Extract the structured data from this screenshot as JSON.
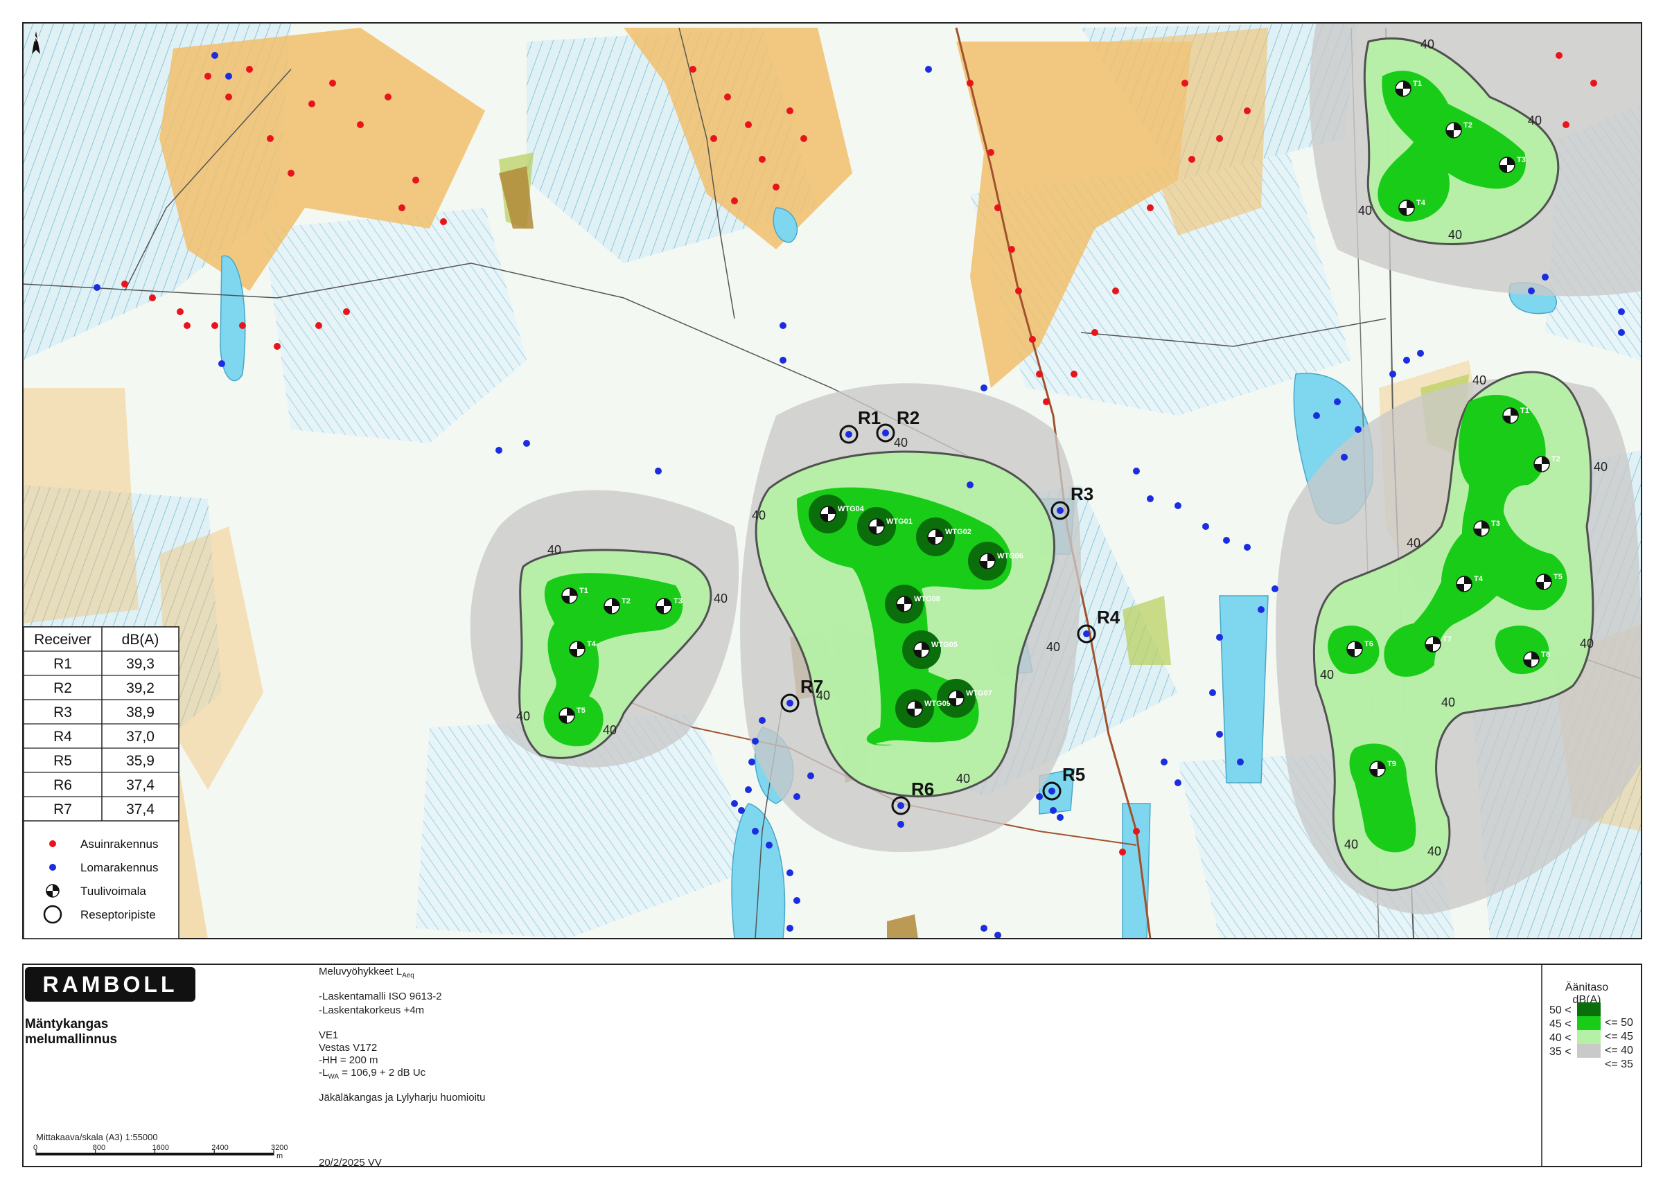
{
  "map": {
    "north_arrow": "N",
    "contour_label": "40"
  },
  "turbines": [
    {
      "id": "t-west-1",
      "label": "T1"
    },
    {
      "id": "t-west-2",
      "label": "T2"
    },
    {
      "id": "t-west-3",
      "label": "T3"
    },
    {
      "id": "t-west-4",
      "label": "T4"
    },
    {
      "id": "t-west-5",
      "label": "T5"
    },
    {
      "id": "wtg04",
      "label": "WTG04"
    },
    {
      "id": "wtg01",
      "label": "WTG01"
    },
    {
      "id": "wtg02",
      "label": "WTG02"
    },
    {
      "id": "wtg06",
      "label": "WTG06"
    },
    {
      "id": "wtg08",
      "label": "WTG08"
    },
    {
      "id": "wtg05",
      "label": "WTG05"
    },
    {
      "id": "wtg09",
      "label": "WTG09"
    },
    {
      "id": "wtg07",
      "label": "WTG07"
    },
    {
      "id": "t-ne-1",
      "label": "T1"
    },
    {
      "id": "t-ne-2",
      "label": "T2"
    },
    {
      "id": "t-ne-3",
      "label": "T3"
    },
    {
      "id": "t-ne-4",
      "label": "T4"
    },
    {
      "id": "t-e-1",
      "label": "T1"
    },
    {
      "id": "t-e-2",
      "label": "T2"
    },
    {
      "id": "t-e-3",
      "label": "T3"
    },
    {
      "id": "t-e-4",
      "label": "T4"
    },
    {
      "id": "t-e-5",
      "label": "T5"
    },
    {
      "id": "t-e-6",
      "label": "T6"
    },
    {
      "id": "t-e-7",
      "label": "T7"
    },
    {
      "id": "t-e-8",
      "label": "T8"
    },
    {
      "id": "t-e-9",
      "label": "T9"
    }
  ],
  "receivers": [
    "R1",
    "R2",
    "R3",
    "R4",
    "R5",
    "R6",
    "R7"
  ],
  "receiver_table": {
    "col_receiver": "Receiver",
    "col_db": "dB(A)",
    "rows": [
      {
        "receiver": "R1",
        "db": "39,3"
      },
      {
        "receiver": "R2",
        "db": "39,2"
      },
      {
        "receiver": "R3",
        "db": "38,9"
      },
      {
        "receiver": "R4",
        "db": "37,0"
      },
      {
        "receiver": "R5",
        "db": "35,9"
      },
      {
        "receiver": "R6",
        "db": "37,4"
      },
      {
        "receiver": "R7",
        "db": "37,4"
      }
    ]
  },
  "legend": {
    "items": [
      {
        "symbol": "red-dot",
        "label": "Asuinrakennus",
        "color": "#e8141c"
      },
      {
        "symbol": "blue-dot",
        "label": "Lomarakennus",
        "color": "#1a2ee0"
      },
      {
        "symbol": "turbine",
        "label": "Tuulivoimala"
      },
      {
        "symbol": "ring",
        "label": "Reseptoripiste"
      }
    ]
  },
  "title_block": {
    "logo": "RAMBOLL",
    "project_line1": "Mäntykangas",
    "project_line2": "melumallinnus",
    "heading": "Meluvyöhykkeet L",
    "heading_sub": "Aeq",
    "model_line": "-Laskentamalli ISO 9613-2",
    "height_line": "-Laskentakorkeus +4m",
    "variant": "VE1",
    "turbine_model": "Vestas V172",
    "hub_height": "-HH = 200 m",
    "lwa_prefix": "-L",
    "lwa_sub": "WA",
    "lwa_value": " = 106,9 + 2 dB Uc",
    "note": "Jäkäläkangas ja Lylyharju huomioitu",
    "scale_text": "Mittakaava/skala (A3) 1:55000",
    "scale_ticks": [
      "0",
      "800",
      "1600",
      "2400",
      "3200"
    ],
    "scale_unit": "m",
    "date": "20/2/2025 VV"
  },
  "noise_legend": {
    "title": "Äänitaso",
    "unit": "dB(A)",
    "left_labels": [
      "50 <",
      "45 <",
      "40 <",
      "35 <"
    ],
    "right_labels": [
      "<= 50",
      "<= 45",
      "<= 40",
      "<= 35"
    ],
    "colors": {
      "band_50": "#0a6e0a",
      "band_45_50": "#18cc18",
      "band_40_45": "#b6f0a6",
      "band_35_40": "#c9c9c9"
    }
  }
}
